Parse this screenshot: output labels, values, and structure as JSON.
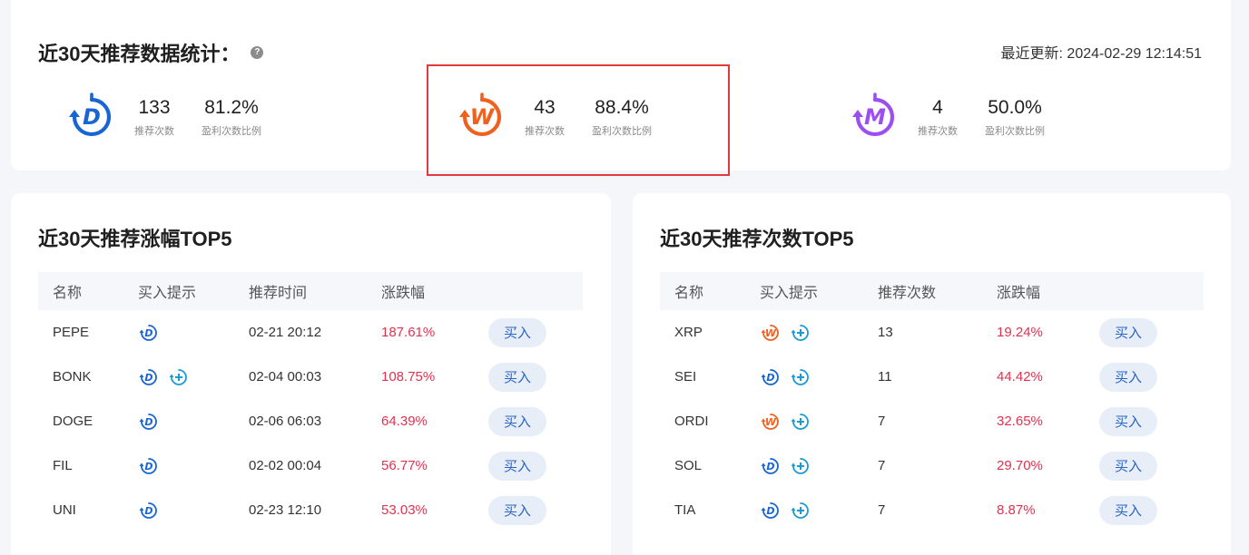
{
  "stats": {
    "title": "近30天推荐数据统计：",
    "help_glyph": "?",
    "last_updated": "最近更新: 2024-02-29 12:14:51",
    "groups": [
      {
        "logo": "D",
        "color": "#1766d4",
        "count": "133",
        "count_label": "推荐次数",
        "ratio": "81.2%",
        "ratio_label": "盈利次数比例"
      },
      {
        "logo": "W",
        "color": "#f0601e",
        "count": "43",
        "count_label": "推荐次数",
        "ratio": "88.4%",
        "ratio_label": "盈利次数比例"
      },
      {
        "logo": "M",
        "color": "#9b4ff0",
        "count": "4",
        "count_label": "推荐次数",
        "ratio": "50.0%",
        "ratio_label": "盈利次数比例"
      }
    ]
  },
  "top_gain": {
    "title": "近30天推荐涨幅TOP5",
    "columns": [
      "名称",
      "买入提示",
      "推荐时间",
      "涨跌幅"
    ],
    "buy_label": "买入",
    "rows": [
      {
        "name": "PEPE",
        "hints": [
          "D"
        ],
        "time": "02-21 20:12",
        "change": "187.61%"
      },
      {
        "name": "BONK",
        "hints": [
          "D",
          "plus"
        ],
        "time": "02-04 00:03",
        "change": "108.75%"
      },
      {
        "name": "DOGE",
        "hints": [
          "D"
        ],
        "time": "02-06 06:03",
        "change": "64.39%"
      },
      {
        "name": "FIL",
        "hints": [
          "D"
        ],
        "time": "02-02 00:04",
        "change": "56.77%"
      },
      {
        "name": "UNI",
        "hints": [
          "D"
        ],
        "time": "02-23 12:10",
        "change": "53.03%"
      }
    ]
  },
  "top_count": {
    "title": "近30天推荐次数TOP5",
    "columns": [
      "名称",
      "买入提示",
      "推荐次数",
      "涨跌幅"
    ],
    "buy_label": "买入",
    "rows": [
      {
        "name": "XRP",
        "hints": [
          "W",
          "plus"
        ],
        "count": "13",
        "change": "19.24%"
      },
      {
        "name": "SEI",
        "hints": [
          "D",
          "plus"
        ],
        "count": "11",
        "change": "44.42%"
      },
      {
        "name": "ORDI",
        "hints": [
          "W",
          "plus"
        ],
        "count": "7",
        "change": "32.65%"
      },
      {
        "name": "SOL",
        "hints": [
          "D",
          "plus"
        ],
        "count": "7",
        "change": "29.70%"
      },
      {
        "name": "TIA",
        "hints": [
          "D",
          "plus"
        ],
        "count": "7",
        "change": "8.87%"
      }
    ]
  },
  "icon_colors": {
    "D": "#1766d4",
    "W": "#f0601e",
    "M": "#9b4ff0",
    "plus": "#1a9bd8"
  }
}
